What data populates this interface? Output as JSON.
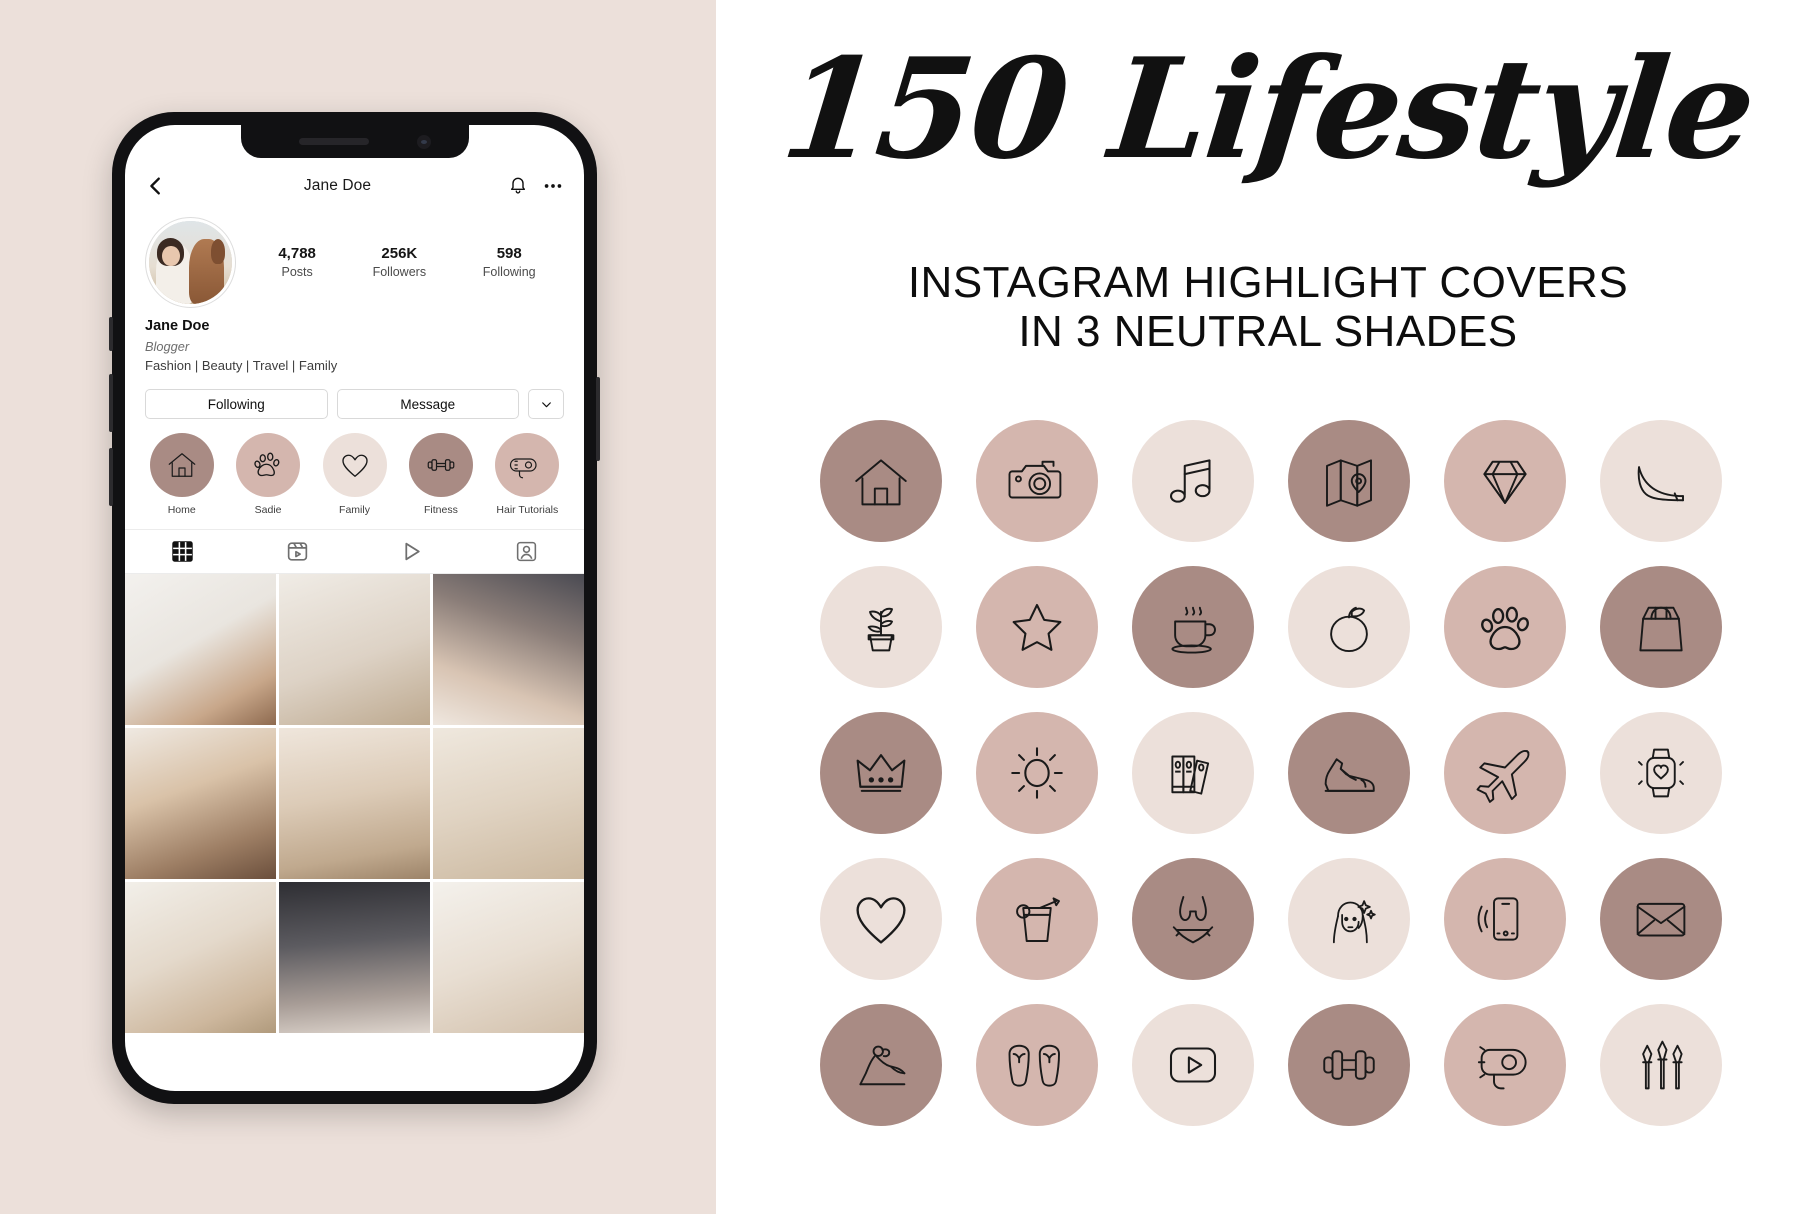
{
  "palette": {
    "panel_bg": "#ece0da",
    "shade_dark": "#a98b84",
    "shade_mid": "#d4b6ae",
    "shade_light": "#ece0da",
    "page_bg": "#ffffff",
    "stroke": "#1a1a1a"
  },
  "right": {
    "headline": "150 Lifestyle",
    "subhead_line1": "INSTAGRAM HIGHLIGHT COVERS",
    "subhead_line2": "IN 3 NEUTRAL SHADES"
  },
  "phone": {
    "header": {
      "title": "Jane Doe",
      "back_icon": "back-chevron-icon",
      "bell_icon": "bell-icon",
      "menu_icon": "more-options-icon"
    },
    "stats": [
      {
        "num": "4,788",
        "label": "Posts"
      },
      {
        "num": "256K",
        "label": "Followers"
      },
      {
        "num": "598",
        "label": "Following"
      }
    ],
    "bio": {
      "name": "Jane Doe",
      "category": "Blogger",
      "tags": "Fashion | Beauty | Travel | Family"
    },
    "actions": {
      "following": "Following",
      "message": "Message",
      "caret_icon": "chevron-down-icon"
    },
    "highlights": [
      {
        "label": "Home",
        "icon": "house-icon",
        "shade": "#a98b84"
      },
      {
        "label": "Sadie",
        "icon": "paw-icon",
        "shade": "#d4b6ae"
      },
      {
        "label": "Family",
        "icon": "heart-icon",
        "shade": "#ece0da"
      },
      {
        "label": "Fitness",
        "icon": "dumbbell-icon",
        "shade": "#a98b84"
      },
      {
        "label": "Hair Tutorials",
        "icon": "hairdryer-icon",
        "shade": "#d4b6ae"
      }
    ],
    "tabs": [
      {
        "name": "grid-tab",
        "icon": "grid-icon",
        "active": true
      },
      {
        "name": "reels-tab",
        "icon": "reels-icon",
        "active": false
      },
      {
        "name": "video-tab",
        "icon": "play-icon",
        "active": false
      },
      {
        "name": "tagged-tab",
        "icon": "tagged-icon",
        "active": false
      }
    ],
    "grid_posts": [
      "laptop-on-bed-photo",
      "skincare-products-photo",
      "coffee-cup-in-hands-photo",
      "woman-portrait-photo",
      "woman-walking-street-photo",
      "dried-flowers-book-photo",
      "woman-laptop-bedroom-photo",
      "hands-typing-laptop-photo",
      "breakfast-in-bed-photo"
    ]
  },
  "icon_grid": {
    "columns": 6,
    "rows": 5,
    "items": [
      {
        "icon": "house-icon",
        "shade": "#a98b84"
      },
      {
        "icon": "camera-icon",
        "shade": "#d4b6ae"
      },
      {
        "icon": "music-note-icon",
        "shade": "#ece0da"
      },
      {
        "icon": "map-icon",
        "shade": "#a98b84"
      },
      {
        "icon": "diamond-icon",
        "shade": "#d4b6ae"
      },
      {
        "icon": "high-heel-icon",
        "shade": "#ece0da"
      },
      {
        "icon": "potted-plant-icon",
        "shade": "#ece0da"
      },
      {
        "icon": "star-icon",
        "shade": "#d4b6ae"
      },
      {
        "icon": "coffee-cup-icon",
        "shade": "#a98b84"
      },
      {
        "icon": "apple-icon",
        "shade": "#ece0da"
      },
      {
        "icon": "paw-icon",
        "shade": "#d4b6ae"
      },
      {
        "icon": "shopping-bag-icon",
        "shade": "#a98b84"
      },
      {
        "icon": "crown-icon",
        "shade": "#a98b84"
      },
      {
        "icon": "sun-icon",
        "shade": "#d4b6ae"
      },
      {
        "icon": "books-icon",
        "shade": "#ece0da"
      },
      {
        "icon": "sneaker-icon",
        "shade": "#a98b84"
      },
      {
        "icon": "airplane-icon",
        "shade": "#d4b6ae"
      },
      {
        "icon": "smartwatch-icon",
        "shade": "#ece0da"
      },
      {
        "icon": "heart-icon",
        "shade": "#ece0da"
      },
      {
        "icon": "smoothie-icon",
        "shade": "#d4b6ae"
      },
      {
        "icon": "bikini-icon",
        "shade": "#a98b84"
      },
      {
        "icon": "woman-face-icon",
        "shade": "#ece0da"
      },
      {
        "icon": "phone-icon",
        "shade": "#d4b6ae"
      },
      {
        "icon": "envelope-icon",
        "shade": "#a98b84"
      },
      {
        "icon": "yoga-pose-icon",
        "shade": "#a98b84"
      },
      {
        "icon": "flip-flops-icon",
        "shade": "#d4b6ae"
      },
      {
        "icon": "play-button-icon",
        "shade": "#ece0da"
      },
      {
        "icon": "dumbbell-icon",
        "shade": "#a98b84"
      },
      {
        "icon": "hairdryer-icon",
        "shade": "#d4b6ae"
      },
      {
        "icon": "makeup-brush-icon",
        "shade": "#ece0da"
      }
    ]
  }
}
